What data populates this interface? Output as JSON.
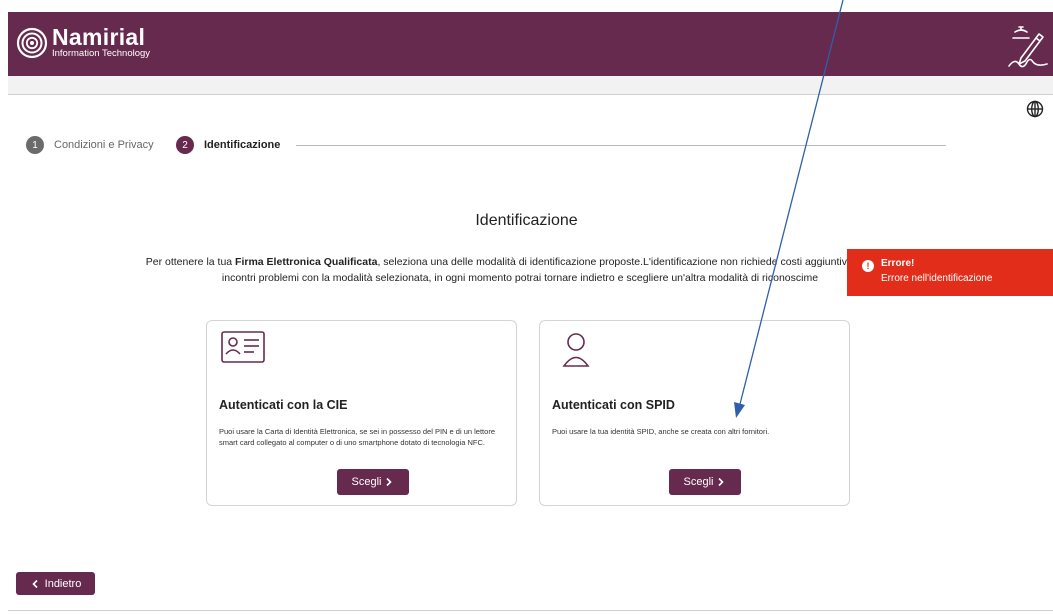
{
  "header": {
    "brand": "Namirial",
    "brand_sub": "Information Technology",
    "logo_icon": "namirial-logo-icon",
    "sign_icon": "signature-pen-icon",
    "color": "#662a4e"
  },
  "language_icon": "globe-icon",
  "stepper": {
    "steps": [
      {
        "number": "1",
        "label": "Condizioni e Privacy",
        "state": "done"
      },
      {
        "number": "2",
        "label": "Identificazione",
        "state": "active"
      }
    ]
  },
  "main": {
    "title": "Identificazione",
    "description": {
      "prefix": "Per ottenere la tua ",
      "bold": "Firma Elettronica Qualificata",
      "line1_rest": ", seleziona una delle modalità di identificazione proposte.L'identificazione non richiede costi aggiuntivi, salvo qu",
      "line2": "incontri problemi con la modalità selezionata, in ogni momento potrai tornare indietro e scegliere un'altra modalità di riconoscime"
    }
  },
  "cards": [
    {
      "icon": "id-card-icon",
      "title": "Autenticati con la CIE",
      "text": "Puoi usare la Carta di Identità Elettronica, se sei in possesso del PIN e di un lettore smart card collegato al computer o di uno smartphone dotato di tecnologia NFC.",
      "button": "Scegli"
    },
    {
      "icon": "user-icon",
      "title": "Autenticati con SPID",
      "text": "Puoi usare la tua identità SPID, anche se creata con altri fornitori.",
      "button": "Scegli"
    }
  ],
  "back_button": "Indietro",
  "toast": {
    "title": "Errore!",
    "message": "Errore nell'identificazione",
    "color": "#e12d19",
    "icon": "error-icon"
  },
  "annotation": {
    "type": "arrow",
    "color": "#2f5fa8"
  }
}
